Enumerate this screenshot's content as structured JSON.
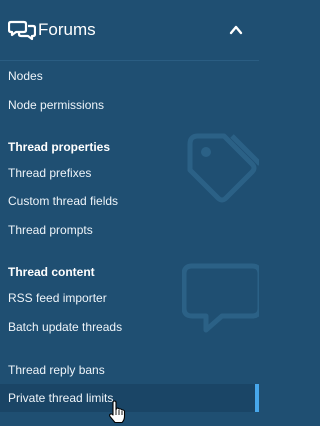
{
  "header": {
    "title": "Forums",
    "icon": "forums-chat-icon",
    "toggle_icon": "chevron-up-icon"
  },
  "items": {
    "nodes": "Nodes",
    "node_permissions": "Node permissions",
    "thread_prefixes": "Thread prefixes",
    "custom_thread_fields": "Custom thread fields",
    "thread_prompts": "Thread prompts",
    "rss_feed_importer": "RSS feed importer",
    "batch_update_threads": "Batch update threads",
    "thread_reply_bans": "Thread reply bans",
    "private_thread_limits": "Private thread limits"
  },
  "sections": {
    "thread_properties": "Thread properties",
    "thread_content": "Thread content"
  },
  "active_item": "Private thread limits",
  "colors": {
    "background": "#1f4f72",
    "active_background": "#1a4566",
    "active_indicator": "#47a7eb",
    "text": "#ffffff"
  }
}
